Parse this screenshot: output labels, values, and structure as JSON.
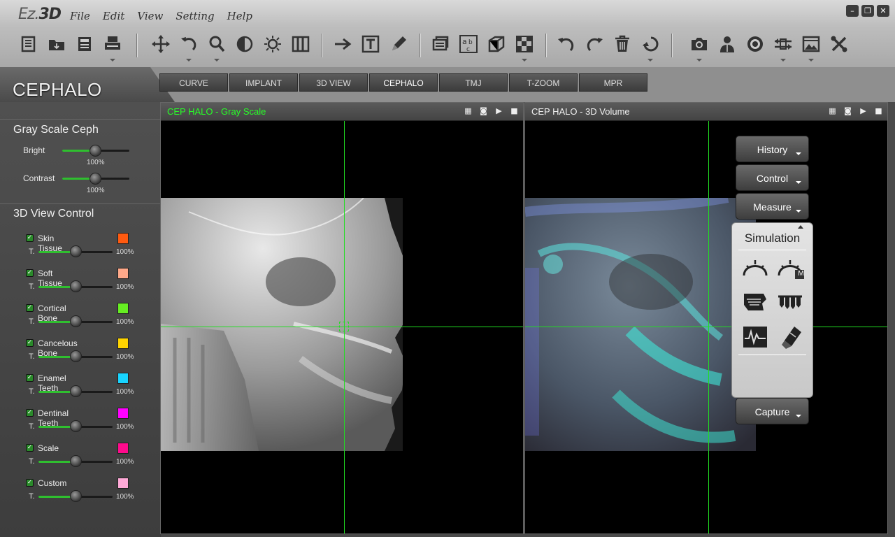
{
  "app": {
    "logo_prefix": "Ez",
    "logo_suffix": "3D"
  },
  "menu": [
    "File",
    "Edit",
    "View",
    "Setting",
    "Help"
  ],
  "window_controls": {
    "minimize": "–",
    "restore": "❐",
    "close": "✕"
  },
  "module_title": "CEPHALO",
  "tabs": [
    "CURVE",
    "IMPLANT",
    "3D VIEW",
    "CEPHALO",
    "TMJ",
    "T-ZOOM",
    "MPR"
  ],
  "active_tab": "CEPHALO",
  "gray_scale": {
    "title": "Gray Scale Ceph",
    "bright": {
      "label": "Bright",
      "value": "100%",
      "level": 0.5
    },
    "contrast": {
      "label": "Contrast",
      "value": "100%",
      "level": 0.5
    }
  },
  "view_control": {
    "title": "3D View Control",
    "t_label": "T.",
    "layers": [
      {
        "name": "Skin Tissue",
        "color": "#ff5a10",
        "value": "100%",
        "level": 0.5
      },
      {
        "name": "Soft Tissue",
        "color": "#ffa98a",
        "value": "100%",
        "level": 0.5
      },
      {
        "name": "Cortical Bone",
        "color": "#66ee22",
        "value": "100%",
        "level": 0.5
      },
      {
        "name": "Cancelous Bone",
        "color": "#ffd400",
        "value": "100%",
        "level": 0.5
      },
      {
        "name": "Enamel Teeth",
        "color": "#18d4ff",
        "value": "100%",
        "level": 0.5
      },
      {
        "name": "Dentinal Teeth",
        "color": "#ff00ff",
        "value": "100%",
        "level": 0.5
      },
      {
        "name": "Scale",
        "color": "#ff0a8c",
        "value": "100%",
        "level": 0.5
      },
      {
        "name": "Custom",
        "color": "#ffaad8",
        "value": "100%",
        "level": 0.5
      }
    ]
  },
  "viewer_left": {
    "title": "CEP HALO - Gray Scale",
    "title_color": "#27ff27"
  },
  "viewer_right": {
    "title": "CEP HALO - 3D Volume",
    "title_color": "#f0f0f0"
  },
  "float_panel": {
    "history": "History",
    "control": "Control",
    "measure": "Measure",
    "simulation": "Simulation",
    "capture": "Capture",
    "sim_badge": "M"
  },
  "colors": {
    "accent_green": "#2fbf2f",
    "crosshair": "#22dd22"
  }
}
